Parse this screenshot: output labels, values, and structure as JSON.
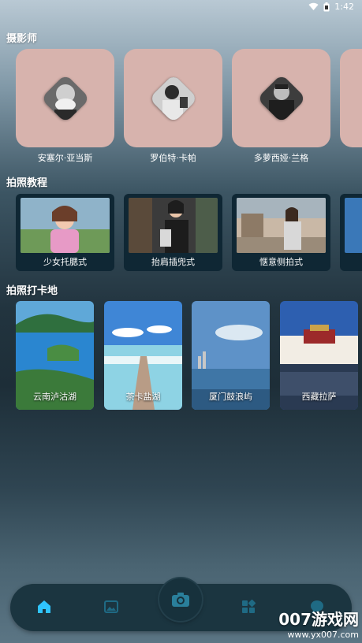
{
  "status": {
    "time": "1:42"
  },
  "sections": {
    "photographers": "摄影师",
    "tutorials": "拍照教程",
    "spots": "拍照打卡地"
  },
  "photographers": [
    {
      "name": "安塞尔·亚当斯"
    },
    {
      "name": "罗伯特·卡帕"
    },
    {
      "name": "多萝西娅·兰格"
    }
  ],
  "tutorials": [
    {
      "label": "少女托腮式"
    },
    {
      "label": "抬肩插兜式"
    },
    {
      "label": "惬意侧拍式"
    }
  ],
  "spots": [
    {
      "label": "云南泸沽湖"
    },
    {
      "label": "茶卡盐湖"
    },
    {
      "label": "厦门鼓浪屿"
    },
    {
      "label": "西藏拉萨"
    }
  ],
  "nav": {
    "items": [
      "home-icon",
      "gallery-icon",
      "camera-icon",
      "apps-icon",
      "message-icon"
    ],
    "active_color": "#2fc4ff"
  },
  "watermark": {
    "line1": "007游戏网",
    "line2": "www.yx007.com"
  },
  "colors": {
    "photographer_card": "#d7b3ad",
    "tutorial_card": "#0f2734"
  }
}
